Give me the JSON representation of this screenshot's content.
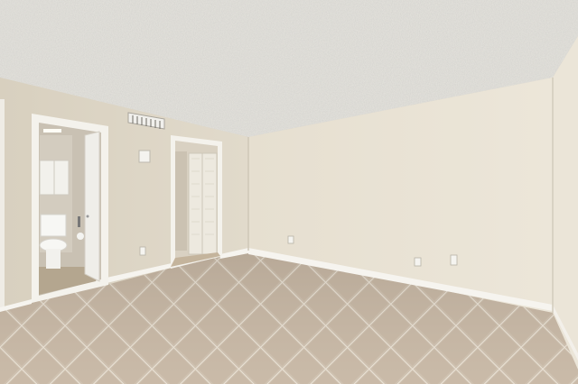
{
  "scene": {
    "type": "interior-photo",
    "room": "empty bedroom",
    "features": [
      "textured-ceiling",
      "tile-floor",
      "open-bathroom-door",
      "open-closet-doorway",
      "ceiling-vent",
      "wall-outlets",
      "light-switch"
    ],
    "colors": {
      "ceiling": "#e6e4de",
      "wall_left": "#ddd6c6",
      "wall_back": "#e6e0d2",
      "wall_right": "#ece7da",
      "floor": "#c9baa8",
      "grout": "#ebe3d6",
      "baseboard": "#f6f4ef"
    }
  }
}
